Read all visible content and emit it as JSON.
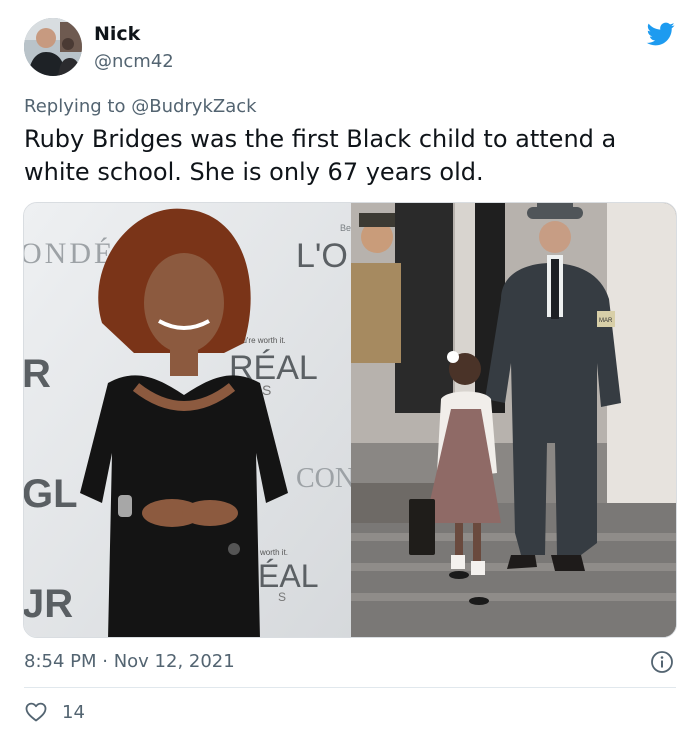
{
  "author": {
    "name": "Nick",
    "handle": "@ncm42"
  },
  "reply": {
    "prefix": "Replying to",
    "mention": "@BudrykZack"
  },
  "tweet": {
    "text": "Ruby Bridges was the first Black child to attend a white school. She is only 67 years old."
  },
  "media": {
    "left_backdrop": {
      "text_1": "ONDÉ",
      "text_2": "L'O",
      "text_3": "you're worth it.",
      "text_4": "RÉAL",
      "text_5": "R",
      "text_6": "GL",
      "text_7": "CON",
      "text_8": "worth it.",
      "text_9": "ÉAL",
      "text_10": "JR",
      "text_11": "S",
      "text_12": "S",
      "text_13": "Be"
    },
    "right_photo": {
      "armband": "MAR"
    }
  },
  "meta": {
    "timestamp": "8:54 PM · Nov 12, 2021"
  },
  "stats": {
    "likes": "14"
  },
  "icons": {
    "brand": "twitter-bird-icon",
    "info": "info-icon",
    "like": "heart-icon"
  },
  "colors": {
    "twitter_blue": "#1d9bf0",
    "secondary_text": "#536471"
  }
}
